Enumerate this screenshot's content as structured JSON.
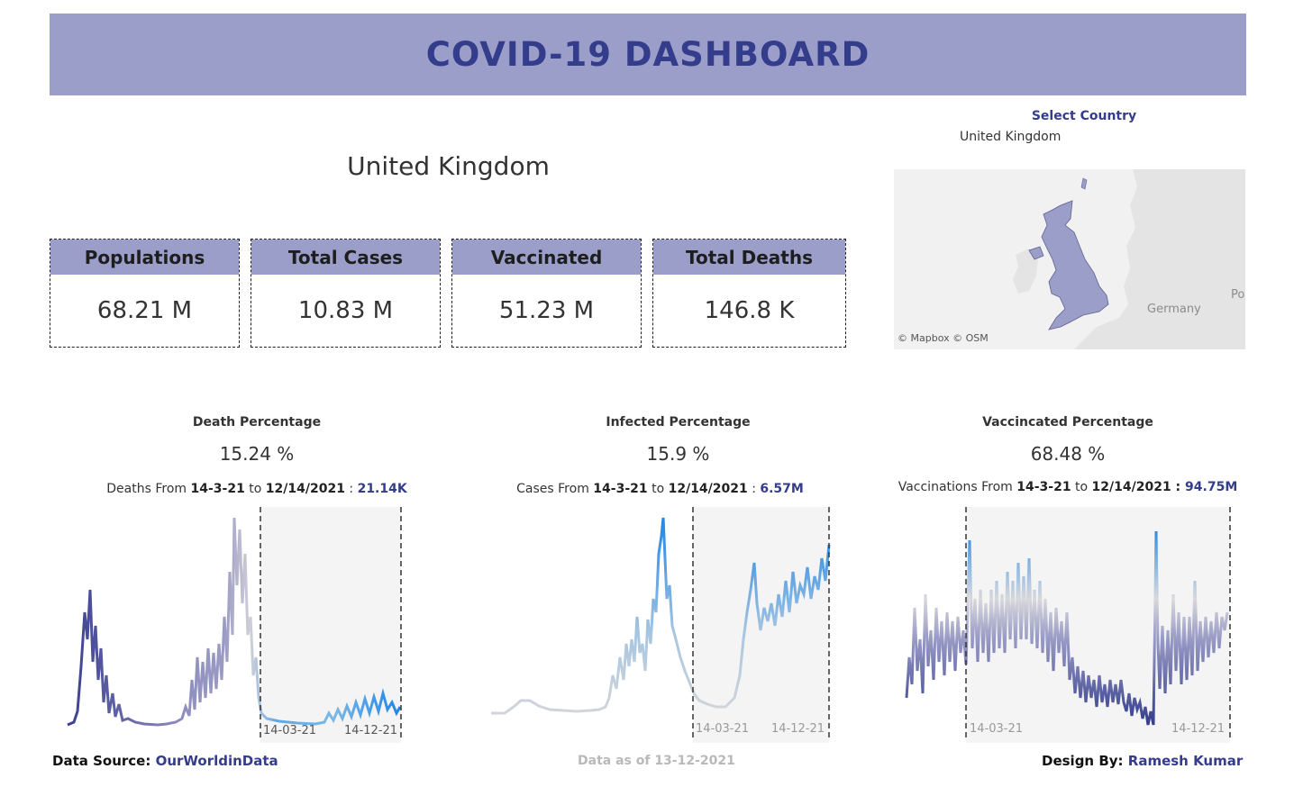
{
  "header": {
    "title": "COVID-19 DASHBOARD"
  },
  "country": {
    "name": "United Kingdom"
  },
  "filter": {
    "label": "Select Country",
    "value": "United Kingdom"
  },
  "map": {
    "credit": "© Mapbox © OSM",
    "label_germany": "Germany",
    "label_po": "Po"
  },
  "kpis": [
    {
      "label": "Populations",
      "value": "68.21 M"
    },
    {
      "label": "Total Cases",
      "value": "10.83 M"
    },
    {
      "label": "Vaccinated",
      "value": "51.23 M"
    },
    {
      "label": "Total Deaths",
      "value": "146.8  K"
    }
  ],
  "panels": [
    {
      "title": "Death Percentage",
      "value": "15.24 %",
      "range_prefix": "Deaths From ",
      "from": "14-3-21",
      "to_word": " to ",
      "to": "12/14/2021",
      "sep": " : ",
      "total": "21.14K",
      "band_start": "14-03-21",
      "band_end": "14-12-21"
    },
    {
      "title": "Infected Percentage",
      "value": "15.9 %",
      "range_prefix": "Cases From ",
      "from": "14-3-21",
      "to_word": " to ",
      "to": "12/14/2021",
      "sep": " : ",
      "total": "6.57M",
      "band_start": "14-03-21",
      "band_end": "14-12-21"
    },
    {
      "title": "Vaccincated Percentage",
      "value": "68.48 %",
      "range_prefix": "Vaccinations From ",
      "from": "14-3-21",
      "to_word": " to ",
      "to": "12/14/2021",
      "sep": " : ",
      "total": "94.75M",
      "band_start": "14-03-21",
      "band_end": "14-12-21"
    }
  ],
  "footer": {
    "source_label": "Data Source: ",
    "source_link": "OurWorldinData",
    "as_of": "Data as of 13-12-2021",
    "design_label": "Design By: ",
    "design_name": "Ramesh Kumar"
  },
  "colors": {
    "accent": "#343d8c",
    "header_bg": "#9b9ec8",
    "band": "#f4f4f4",
    "blue": "#2b8be6"
  }
}
